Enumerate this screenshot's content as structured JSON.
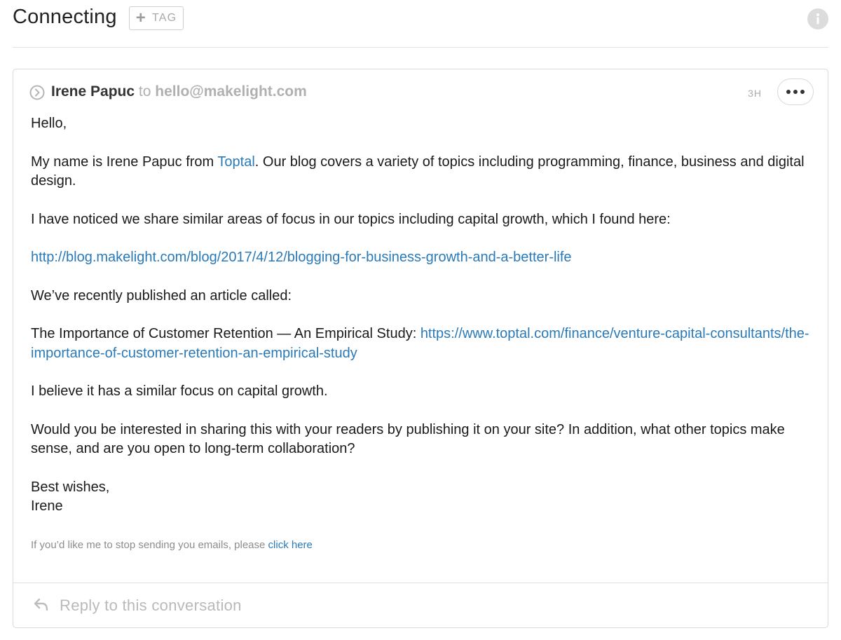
{
  "header": {
    "title": "Connecting",
    "tag_label": "TAG"
  },
  "message": {
    "sender": "Irene Papuc",
    "to_word": "to",
    "recipient": "hello@makelight.com",
    "time": "3H",
    "body": {
      "greeting": "Hello,",
      "p1_before": "My name is Irene Papuc from ",
      "p1_link": "Toptal",
      "p1_after": ". Our blog covers a variety of topics including programming, finance, business and digital design.",
      "p2": "I have noticed we share similar areas of focus in our topics including capital growth, which I found here:",
      "link1": "http://blog.makelight.com/blog/2017/4/12/blogging-for-business-growth-and-a-better-life",
      "p3": "We’ve recently published an article called:",
      "p4_before": "The Importance of Customer Retention — An Empirical Study: ",
      "p4_link": "https://www.toptal.com/finance/venture-capital-consultants/the-importance-of-customer-retention-an-empirical-study",
      "p5": "I believe it has a similar focus on capital growth.",
      "p6": "Would you be interested in sharing this with your readers by publishing it on your site? In addition, what other topics make sense, and are you open to long-term collaboration?",
      "closing": "Best wishes,",
      "signature": "Irene"
    },
    "footer_text": "If you’d like me to stop sending you emails, please ",
    "footer_link": "click here"
  },
  "reply": {
    "placeholder": "Reply to this conversation"
  },
  "colors": {
    "link": "#2a7ab8",
    "muted": "#b0b0b0"
  },
  "icons": [
    "plus-icon",
    "info-icon",
    "expand-icon",
    "more-icon",
    "reply-icon"
  ]
}
